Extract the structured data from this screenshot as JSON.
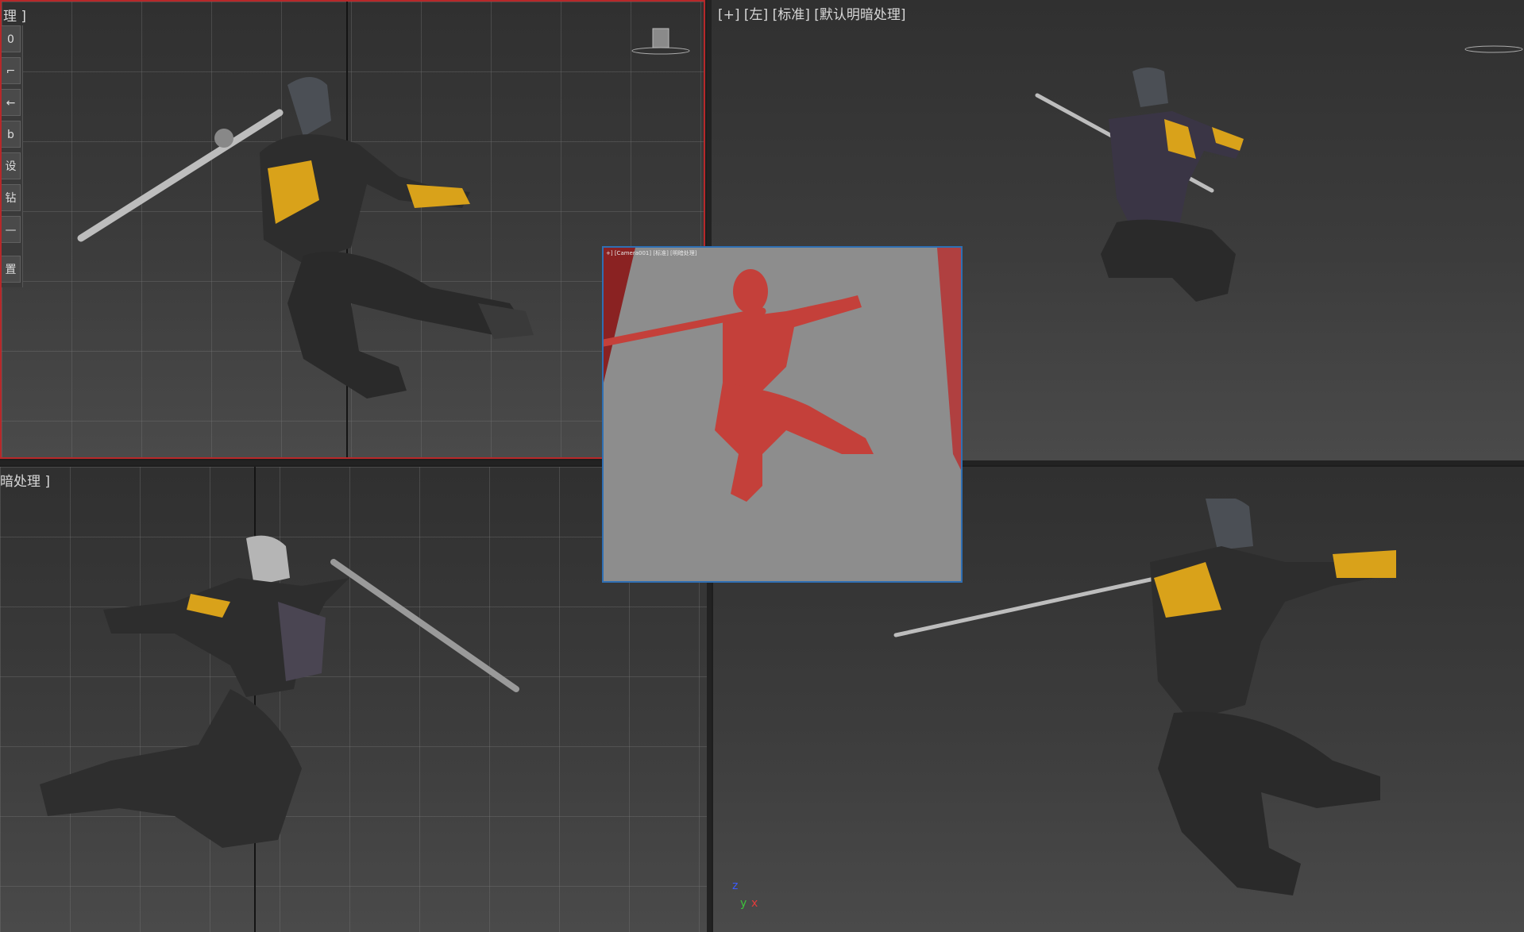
{
  "viewports": {
    "top_left": {
      "label": "理 ]"
    },
    "top_right": {
      "label": "[+] [左] [标准] [默认明暗处理]"
    },
    "bottom_left": {
      "label": "暗处理 ]"
    },
    "bottom_right": {
      "label": ""
    }
  },
  "inset_camera": {
    "label": "+] [Camera001] [标准] [明暗处理]"
  },
  "left_toolbar": {
    "buttons": [
      "0",
      "⌐",
      "←",
      "b",
      "设",
      "钻",
      "—",
      "置"
    ]
  },
  "axis": {
    "x": "x",
    "y": "y",
    "z": "z"
  },
  "colors": {
    "active_border": "#b7282a",
    "inset_border": "#2f6fb3",
    "ninja_armor": "#d9a21a",
    "ninja_body": "#2c2c2c",
    "clay_figure": "#c4403a"
  }
}
